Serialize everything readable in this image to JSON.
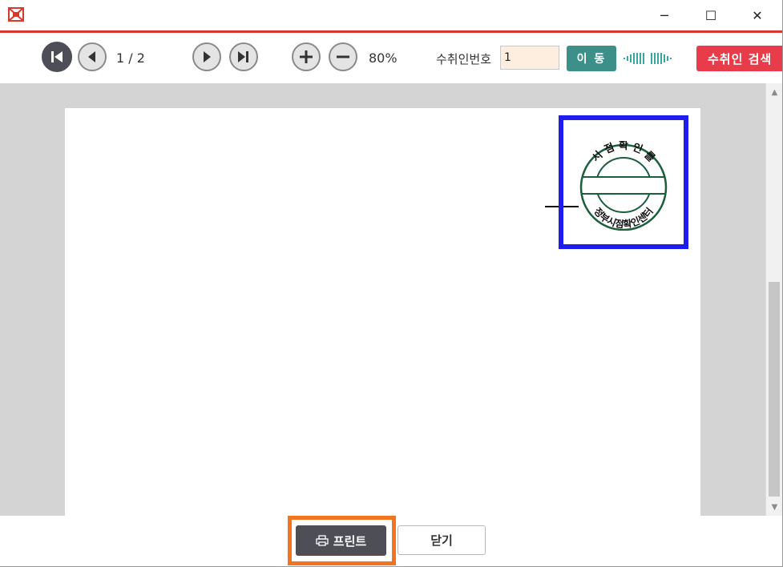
{
  "window": {
    "logo_icon": "app-logo-icon",
    "controls": {
      "minimize": "─",
      "maximize": "☐",
      "close": "✕"
    },
    "accent_color": "#d9392c"
  },
  "toolbar": {
    "page_indicator": "1 / 2",
    "zoom_level": "80%",
    "recipient_label": "수취인번호",
    "recipient_value": "1",
    "go_label": "이 동",
    "search_label": "수취인 검색",
    "colors": {
      "go": "#3d8f8a",
      "search": "#e83c4a",
      "recipient_bg": "#fdeee0"
    },
    "icons": [
      "first-page-icon",
      "prev-page-icon",
      "next-page-icon",
      "last-page-icon",
      "zoom-in-icon",
      "zoom-out-icon",
      "barcode-left-icon",
      "barcode-right-icon"
    ]
  },
  "document": {
    "stamp": {
      "top_text": "시 점 확 인 를",
      "bottom_text": "정부시점확인센터",
      "ink_color": "#1a5e3c",
      "highlight_color": "#1d1df0"
    }
  },
  "footer": {
    "print_label": "프린트",
    "close_label": "닫기",
    "highlight_color": "#f4731f"
  }
}
